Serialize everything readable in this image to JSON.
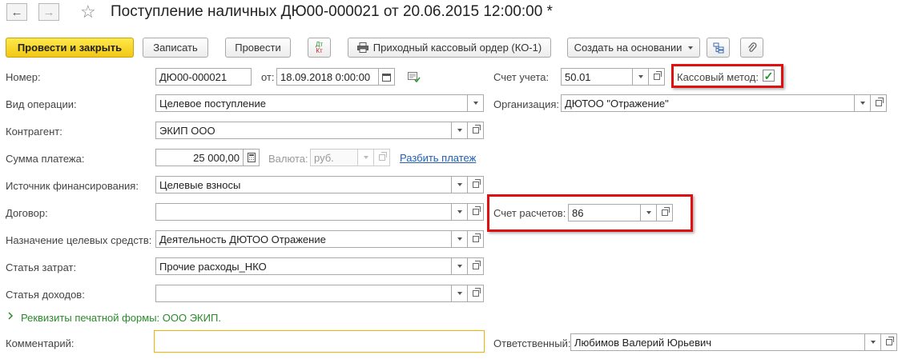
{
  "header": {
    "title": "Поступление наличных ДЮ00-000021 от 20.06.2015 12:00:00 *",
    "back_glyph": "←",
    "forward_glyph": "→",
    "star_glyph": "☆"
  },
  "toolbar": {
    "post_close": "Провести и закрыть",
    "save": "Записать",
    "post": "Провести",
    "dtkt_top": "Дт",
    "dtkt_bottom": "Кт",
    "receipt_order": "Приходный кассовый ордер (КО-1)",
    "create_based": "Создать на основании",
    "structure_icon": "structure-icon",
    "attach_icon": "paperclip-icon"
  },
  "form": {
    "number_label": "Номер:",
    "number_value": "ДЮ00-000021",
    "from_label": "от:",
    "date_value": "18.09.2018  0:00:00",
    "account_label": "Счет учета:",
    "account_value": "50.01",
    "cash_method_label": "Кассовый метод:",
    "cash_method_checked": "✓",
    "operation_label": "Вид операции:",
    "operation_value": "Целевое поступление",
    "org_label": "Организация:",
    "org_value": "ДЮТОО \"Отражение\"",
    "counterparty_label": "Контрагент:",
    "counterparty_value": "ЭКИП ООО",
    "amount_label": "Сумма платежа:",
    "amount_value": "25 000,00",
    "currency_label": "Валюта:",
    "currency_value": "руб.",
    "split_payment": "Разбить платеж",
    "funding_label": "Источник финансирования:",
    "funding_value": "Целевые взносы",
    "contract_label": "Договор:",
    "contract_value": "",
    "settle_label": "Счет расчетов:",
    "settle_value": "86",
    "purpose_label": "Назначение целевых средств:",
    "purpose_value": "Деятельность ДЮТОО Отражение",
    "expense_label": "Статья затрат:",
    "expense_value": "Прочие расходы_НКО",
    "income_label": "Статья доходов:",
    "income_value": "",
    "print_details": "Реквизиты печатной формы: ООО ЭКИП.",
    "comment_label": "Комментарий:",
    "comment_value": "",
    "responsible_label": "Ответственный:",
    "responsible_value": "Любимов Валерий Юрьевич"
  },
  "colors": {
    "primary_button": "#f5d020",
    "highlight_frame": "#e01010",
    "link": "#1f5fb4",
    "green": "#2a8a2a"
  }
}
